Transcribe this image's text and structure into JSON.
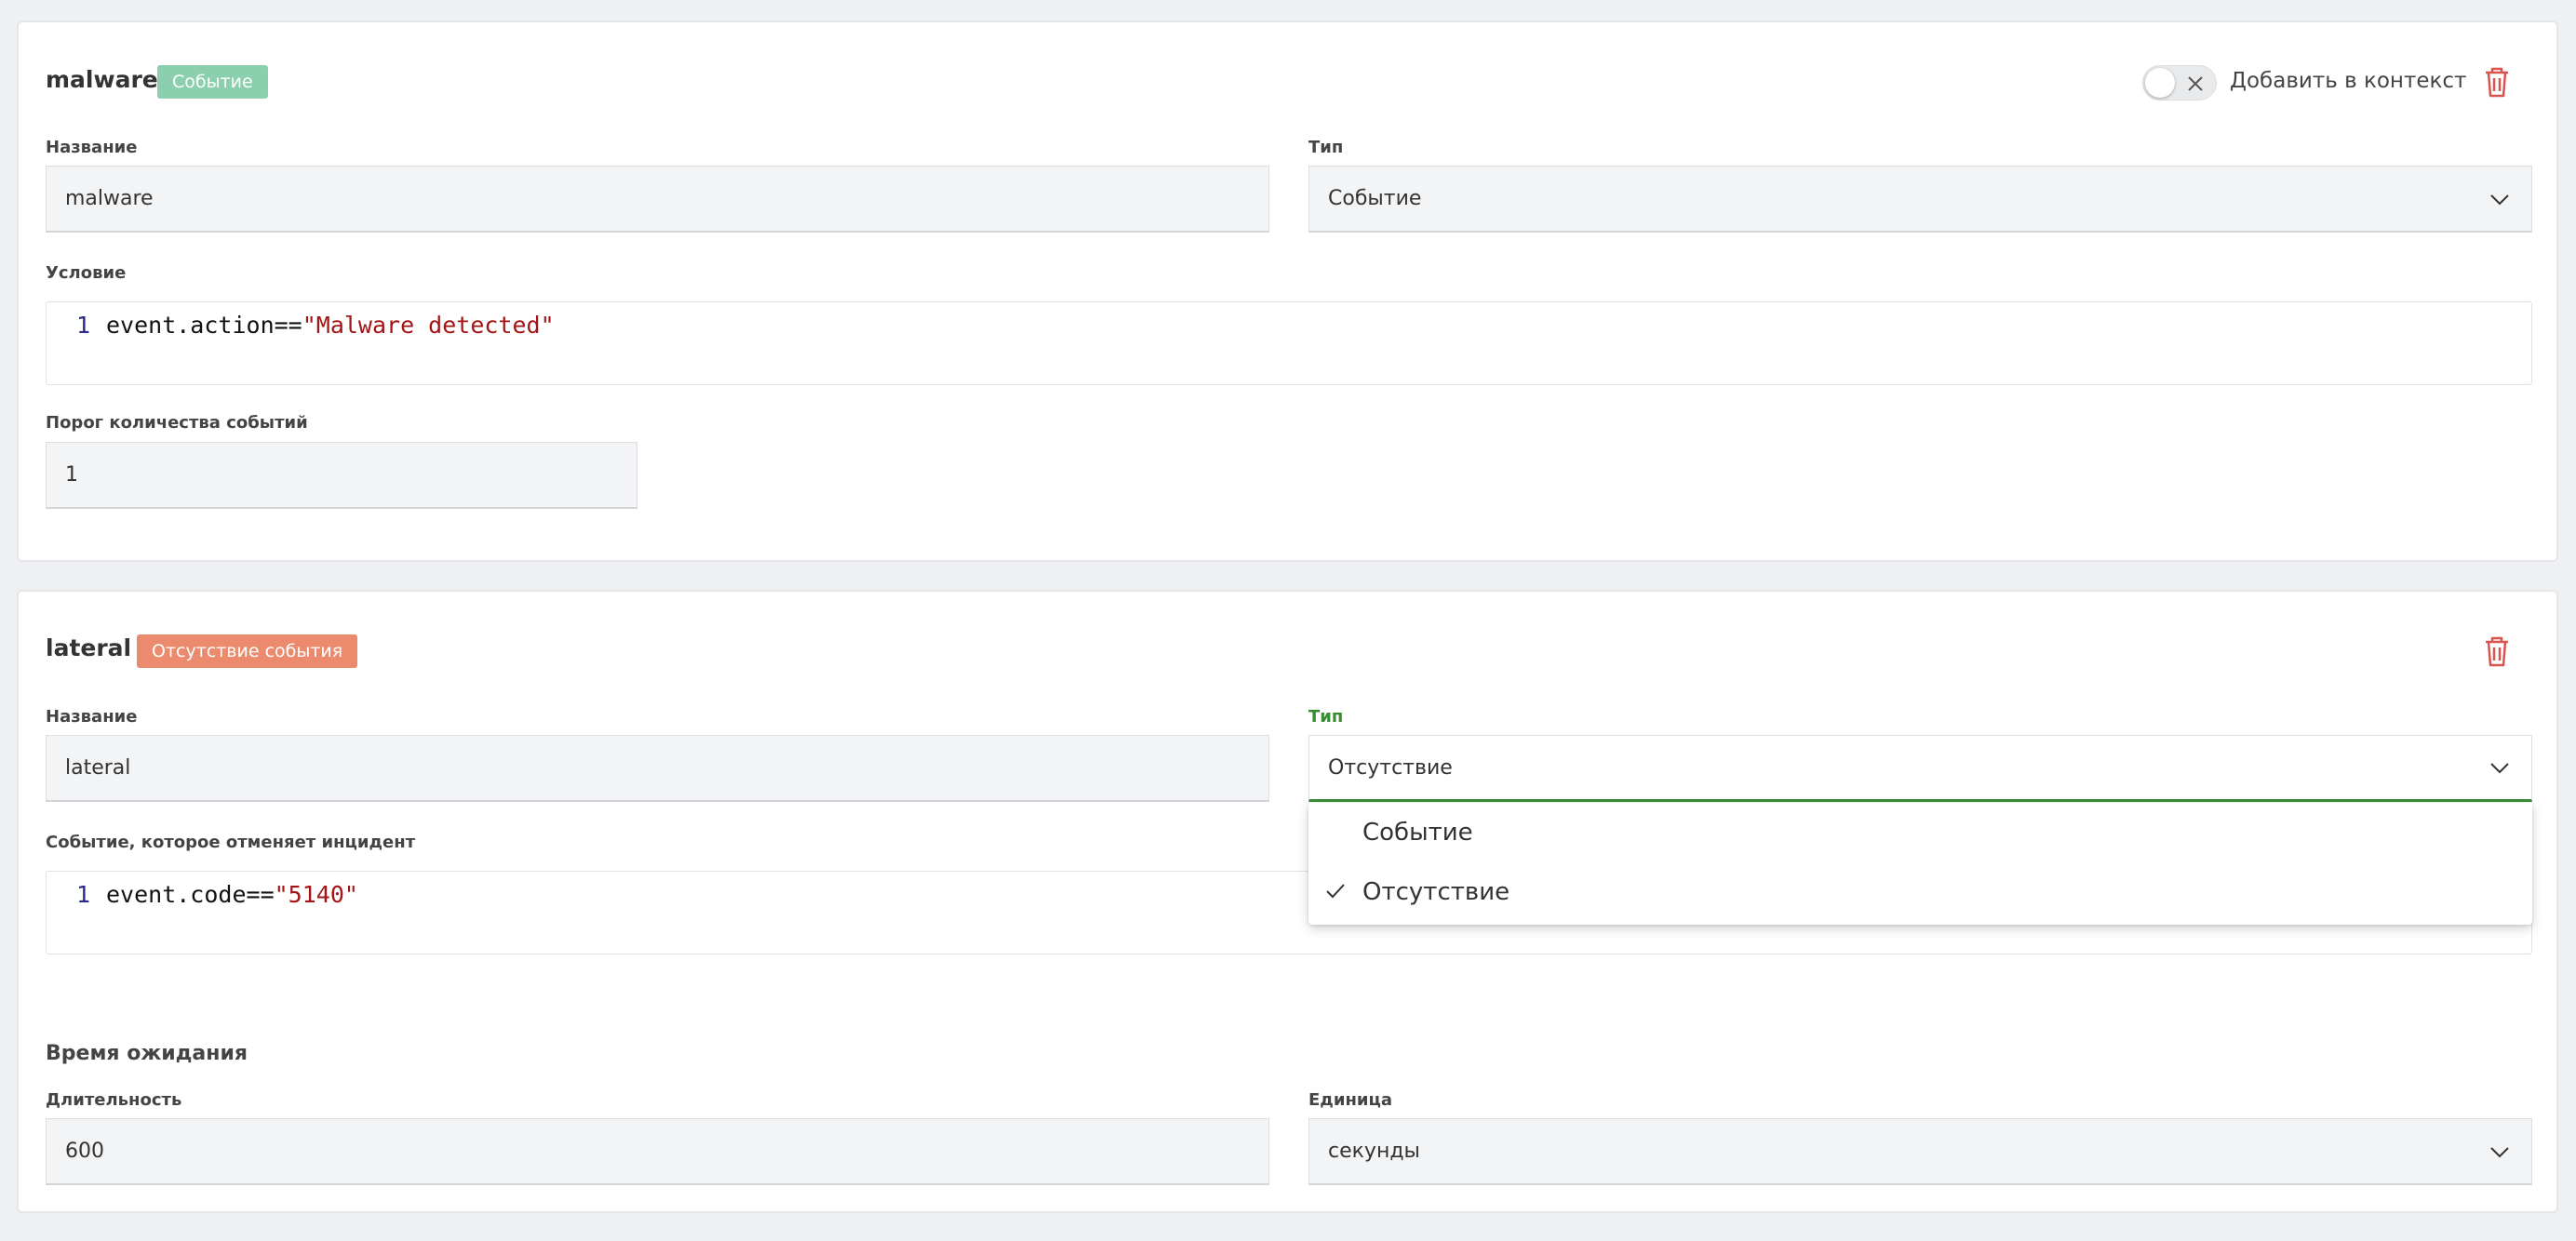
{
  "blocks": [
    {
      "title": "malware",
      "badge": "Событие",
      "toggle_label": "Добавить в контекст",
      "name_label": "Название",
      "name_value": "malware",
      "type_label": "Тип",
      "type_value": "Событие",
      "condition_label": "Условие",
      "code_line_number": "1",
      "code_text": "event.action==",
      "code_string": "\"Malware detected\"",
      "threshold_label": "Порог количества событий",
      "threshold_value": "1"
    },
    {
      "title": "lateral",
      "badge": "Отсутствие события",
      "name_label": "Название",
      "name_value": "lateral",
      "type_label": "Тип",
      "type_value": "Отсутствие",
      "cancel_label": "Событие, которое отменяет инцидент",
      "code_line_number": "1",
      "code_text": "event.code==",
      "code_string": "\"5140\"",
      "wait_title": "Время ожидания",
      "duration_label": "Длительность",
      "duration_value": "600",
      "unit_label": "Единица",
      "unit_value": "секунды"
    }
  ],
  "type_dropdown": {
    "options": [
      "Событие",
      "Отсутствие"
    ],
    "selected": "Отсутствие"
  },
  "colors": {
    "accent_green": "#3a8c34",
    "badge_event": "#8bcfaf",
    "badge_absence": "#ec8a6d",
    "trash_red": "#d9534f"
  }
}
